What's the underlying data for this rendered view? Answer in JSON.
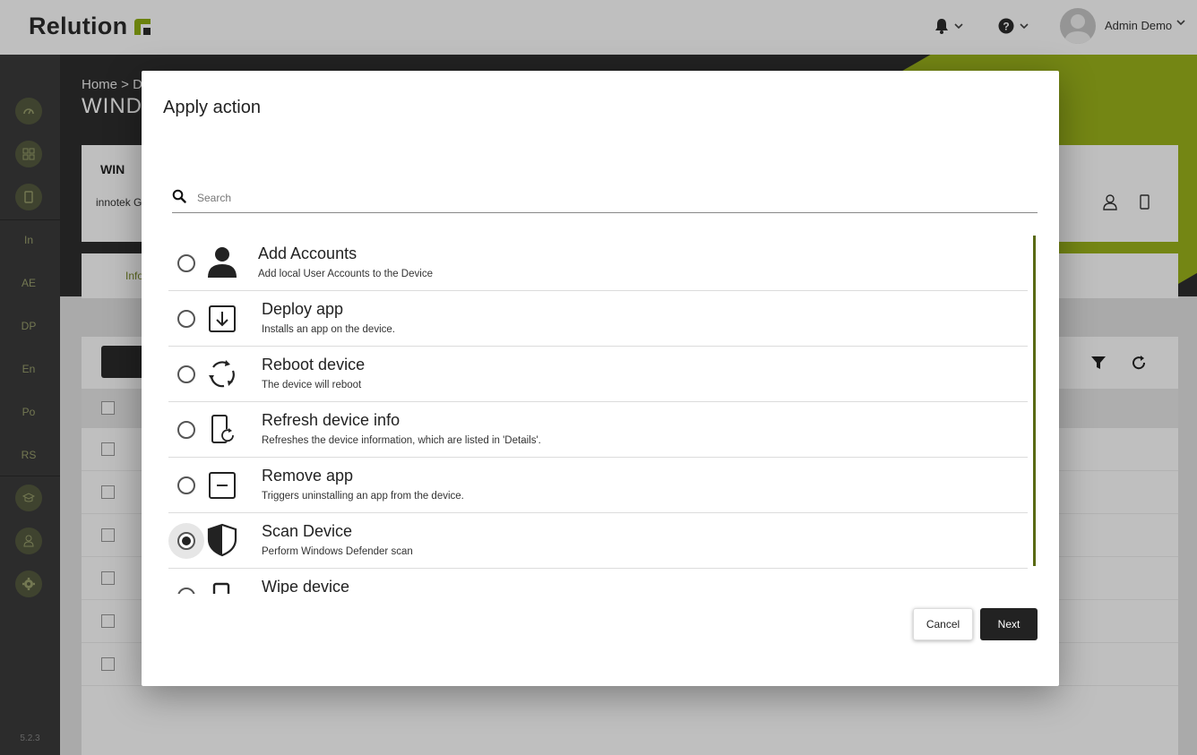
{
  "app": {
    "logo_text": "Relution",
    "brand_color": "#a7c219"
  },
  "topbar": {
    "notifications_icon": "bell-icon",
    "help_icon": "question-icon",
    "user_name": "Admin Demo"
  },
  "sidebar": {
    "items": [
      {
        "icon": "dashboard-icon"
      },
      {
        "icon": "apps-grid-icon"
      },
      {
        "icon": "device-icon"
      },
      {
        "label": "In"
      },
      {
        "label": "AE"
      },
      {
        "label": "DP"
      },
      {
        "label": "En"
      },
      {
        "label": "Po"
      },
      {
        "label": "RS"
      },
      {
        "icon": "academy-icon"
      },
      {
        "icon": "user-icon"
      },
      {
        "icon": "gear-icon"
      }
    ],
    "version": "5.2.3"
  },
  "background_page": {
    "breadcrumb": "Home > D",
    "title": "WINDO",
    "device_card_title": "WIN",
    "device_card_sub": "innotek G",
    "tab_label": "Info"
  },
  "modal": {
    "title": "Apply action",
    "search_placeholder": "Search",
    "options": [
      {
        "title": "Add Accounts",
        "desc": "Add local User Accounts to the Device",
        "icon": "user-icon",
        "selected": false
      },
      {
        "title": "Deploy app",
        "desc": "Installs an app on the device.",
        "icon": "download-box-icon",
        "selected": false
      },
      {
        "title": "Reboot device",
        "desc": "The device will reboot",
        "icon": "reboot-icon",
        "selected": false
      },
      {
        "title": "Refresh device info",
        "desc": "Refreshes the device information, which are listed in 'Details'.",
        "icon": "refresh-device-icon",
        "selected": false
      },
      {
        "title": "Remove app",
        "desc": "Triggers uninstalling an app from the device.",
        "icon": "minus-box-icon",
        "selected": false
      },
      {
        "title": "Scan Device",
        "desc": "Perform Windows Defender scan",
        "icon": "shield-icon",
        "selected": true
      },
      {
        "title": "Wipe device",
        "desc": "",
        "icon": "wipe-device-icon",
        "selected": false
      }
    ],
    "cancel_label": "Cancel",
    "next_label": "Next"
  }
}
